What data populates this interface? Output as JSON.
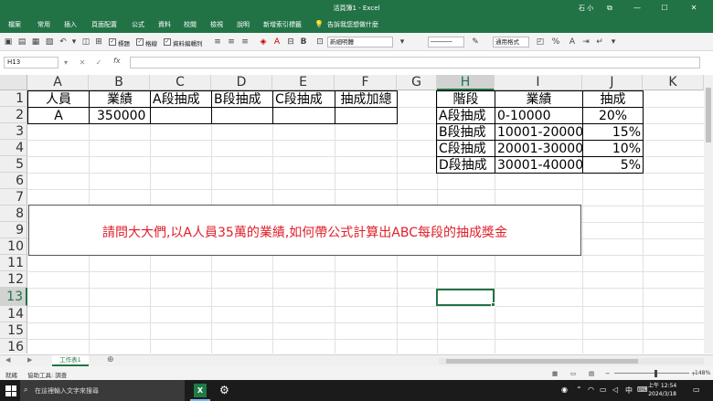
{
  "window": {
    "title": "活頁簿1 - Excel",
    "user": "石 小",
    "controls": [
      "⧉",
      "—",
      "☐",
      "✕"
    ]
  },
  "ribbon_tabs": [
    "檔案",
    "常用",
    "插入",
    "頁面配置",
    "公式",
    "資料",
    "校閱",
    "檢視",
    "說明",
    "新增索引標籤",
    "告訴我您想做什麼"
  ],
  "toolbar": {
    "check_labels": [
      "標題",
      "格線",
      "資料編輯列"
    ],
    "font_name_value": "新細明體",
    "number_format_value": "通用格式"
  },
  "formula_bar": {
    "name_box": "H13",
    "fx": "fx",
    "formula": ""
  },
  "columns": [
    "A",
    "B",
    "C",
    "D",
    "E",
    "F",
    "G",
    "H",
    "I",
    "J",
    "K"
  ],
  "rows": [
    "1",
    "2",
    "3",
    "4",
    "5",
    "6",
    "7",
    "8",
    "9",
    "10",
    "11",
    "12",
    "13",
    "14",
    "15",
    "16"
  ],
  "sheet": {
    "A1": "人員",
    "B1": "業績",
    "C1": "A段抽成",
    "D1": "B段抽成",
    "E1": "C段抽成",
    "F1": "抽成加總",
    "A2": "A",
    "B2": "350000",
    "H1": "階段",
    "I1": "業績",
    "J1": "抽成",
    "H2": "A段抽成",
    "I2": "0-10000",
    "J2": "20%",
    "H3": "B段抽成",
    "I3": "10001-20000",
    "J3": "15%",
    "H4": "C段抽成",
    "I4": "20001-30000",
    "J4": "10%",
    "H5": "D段抽成",
    "I5": "30001-40000",
    "J5": "5%"
  },
  "textbox": "請問大大們,以A人員35萬的業績,如何帶公式計算出ABC每段的抽成獎金",
  "sheet_tab": "工作表1",
  "status": {
    "ready": "就緒",
    "accessibility": "協助工具: 調查",
    "zoom": "148%"
  },
  "taskbar": {
    "search_placeholder": "在這裡輸入文字來搜尋",
    "ime": "中",
    "time": "上午 12:54",
    "date": "2024/3/18"
  }
}
